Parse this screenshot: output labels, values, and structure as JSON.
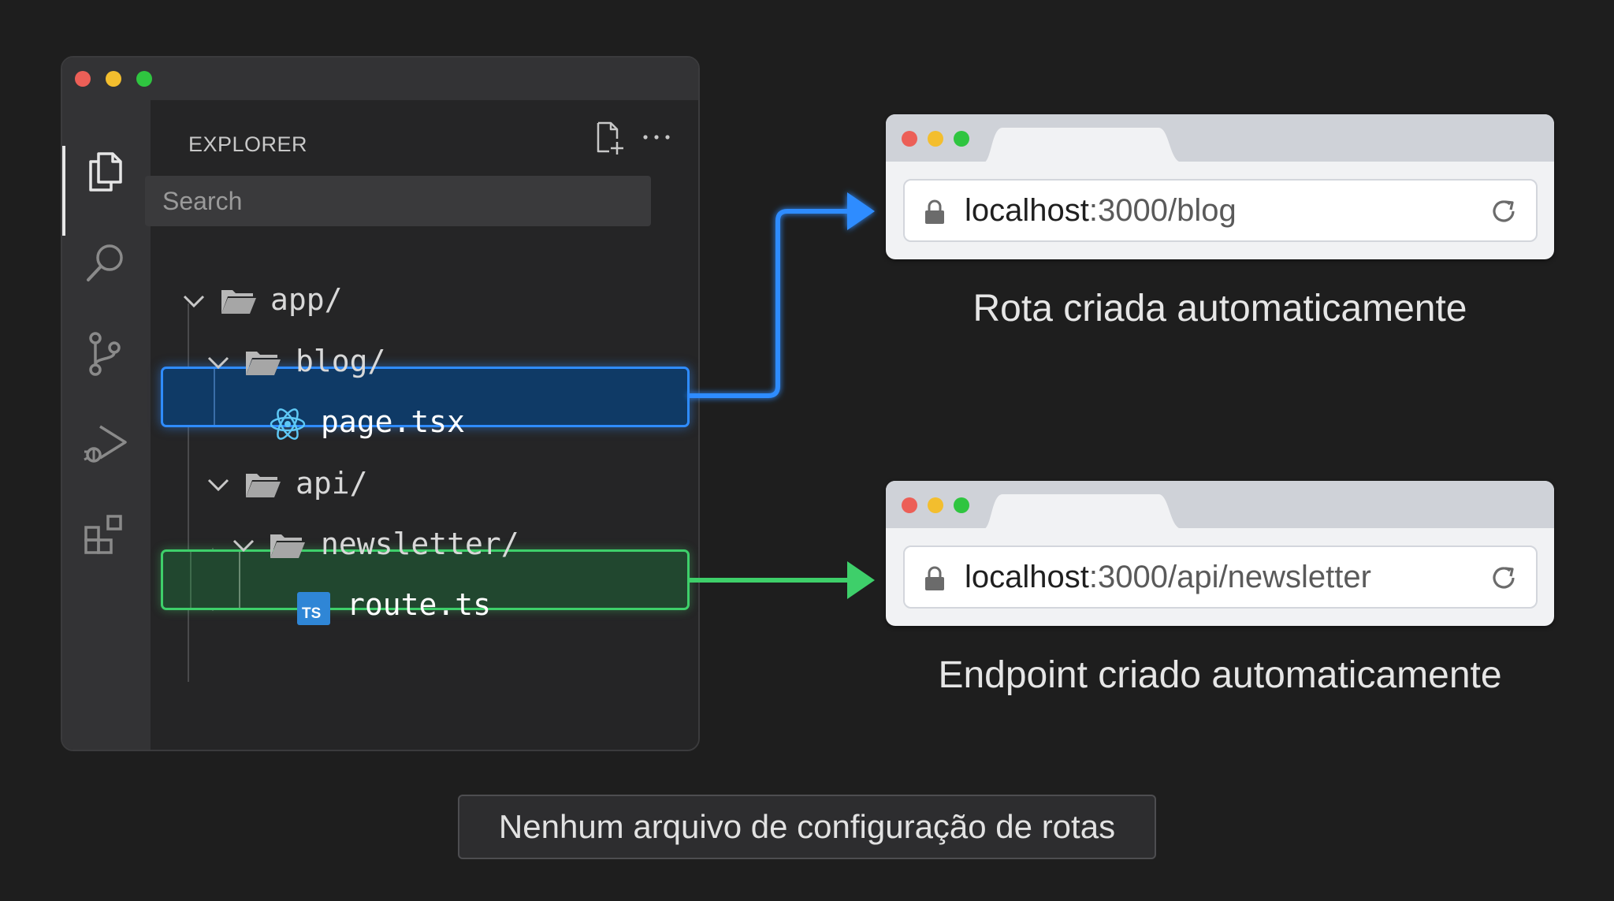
{
  "editor": {
    "explorer_title": "EXPLORER",
    "search_placeholder": "Search",
    "activity_icons": [
      "files-icon",
      "search-icon",
      "source-control-icon",
      "run-debug-icon",
      "extensions-icon"
    ],
    "tree": {
      "app": "app/",
      "blog": "blog/",
      "page": "page.tsx",
      "api": "api/",
      "newsletter": "newsletter/",
      "route": "route.ts",
      "ts_badge": "TS"
    }
  },
  "browser_blog": {
    "host": "localhost",
    "path": ":3000/blog",
    "caption": "Rota criada automaticamente"
  },
  "browser_api": {
    "host": "localhost",
    "path": ":3000/api/newsletter",
    "caption": "Endpoint criado automaticamente"
  },
  "footer": "Nenhum arquivo de configuração de rotas",
  "colors": {
    "background": "#1e1e1e",
    "blue_accent": "#2f8cff",
    "green_accent": "#3ecf6a",
    "react_icon": "#5ec8f5",
    "ts_badge": "#2f86d6"
  }
}
